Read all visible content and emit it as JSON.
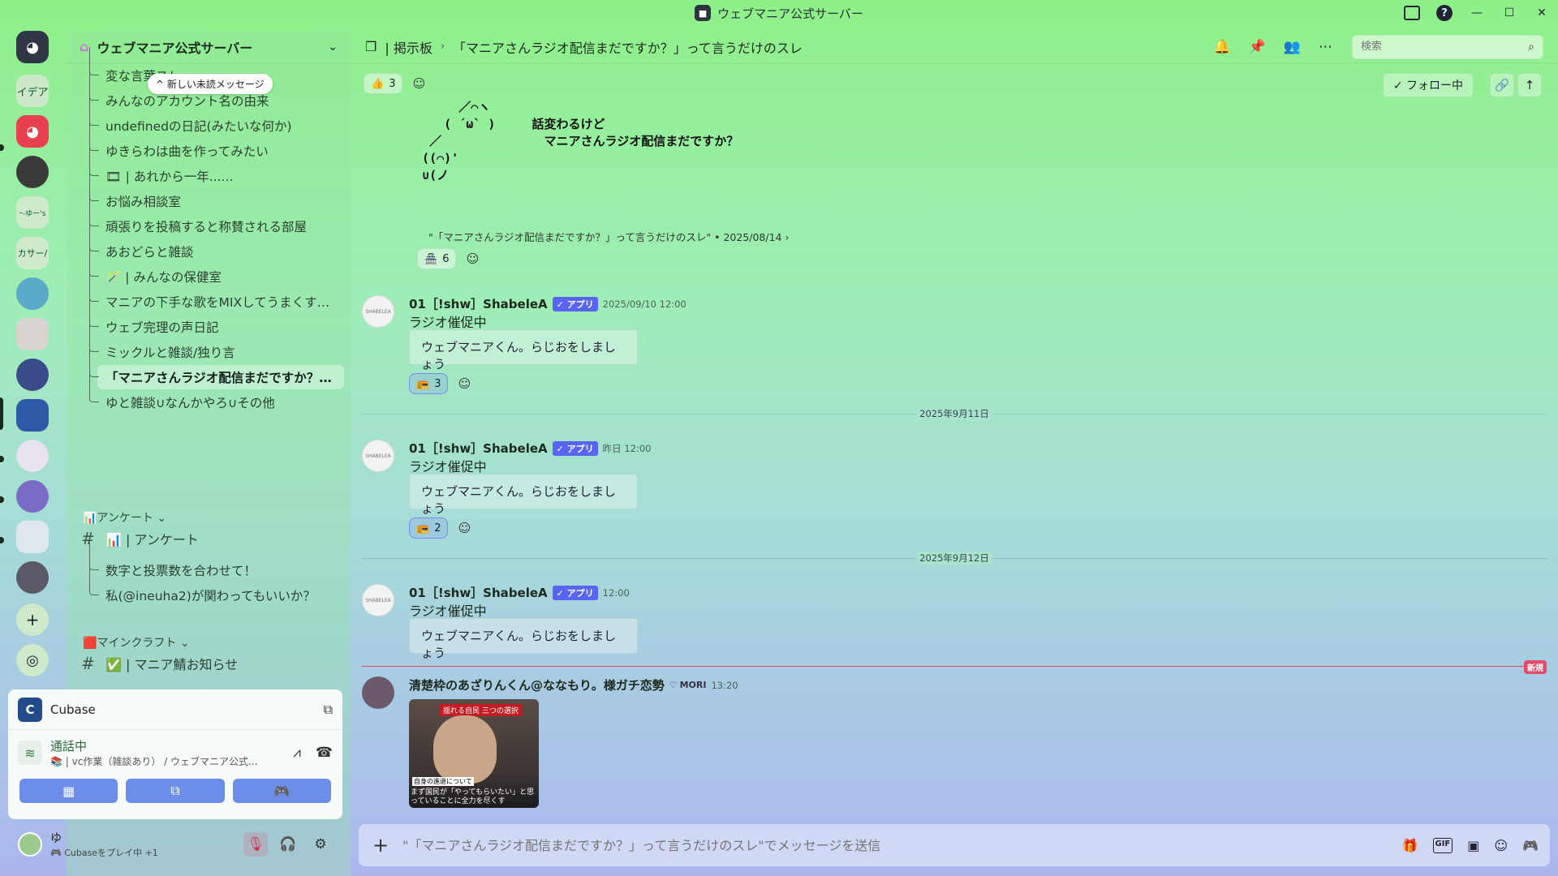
{
  "window": {
    "title": "ウェブマニア公式サーバー",
    "title_icon": "server-logo"
  },
  "rail": {
    "home_icon": "discord-logo",
    "servers": [
      {
        "name": "イデア",
        "label": "イデア"
      },
      {
        "name": "discord",
        "label": ""
      },
      {
        "name": "server-3",
        "label": ""
      },
      {
        "name": "server-4",
        "label": "ｰ-ゆー's"
      },
      {
        "name": "server-5",
        "label": "カサー/"
      },
      {
        "name": "server-6",
        "label": ""
      },
      {
        "name": "server-7",
        "label": ""
      },
      {
        "name": "server-8",
        "label": ""
      },
      {
        "name": "server-9",
        "label": ""
      },
      {
        "name": "server-10",
        "label": ""
      },
      {
        "name": "server-11",
        "label": ""
      },
      {
        "name": "server-12",
        "label": ""
      },
      {
        "name": "server-13",
        "label": ""
      }
    ],
    "add_label": "+",
    "explore_label": "◎"
  },
  "sidebar": {
    "server_name": "ウェブマニア公式サーバー",
    "new_unread": "^ 新しい未読メッセージ",
    "threads": [
      "変な言葉スレ",
      "みんなのアカウント名の由来",
      "undefinedの日記(みたいな何か)",
      "ゆきらわは曲を作ってみたい",
      "🎞 | あれから一年......",
      "お悩み相談室",
      "頑張りを投稿すると称賛される部屋",
      "あおどらと雑談",
      "🪄 | みんなの保健室",
      "マニアの下手な歌をMIXしてうまくする部屋",
      "ウェブ完理の声日記",
      "ミックルと雑談/独り言",
      "「マニアさんラジオ配信まだですか？」って言うだけのスレ",
      "ゆと雑談∪なんかやろ∪その他"
    ],
    "active_index": 12,
    "category_poll": "📊アンケート ⌄",
    "poll_channel": "📊 | アンケート",
    "poll_threads": [
      "数字と投票数を合わせて！",
      "私(@ineuha2)が関わってもいいか？"
    ],
    "category_mc": "🟥マインクラフト ⌄",
    "mc_channel": "✅ | マニア鯖お知らせ"
  },
  "activity": {
    "app_name": "Cubase",
    "voice_status": "通話中",
    "voice_channel": "📚 | vc作業（雑談あり） / ウェブマニア公式...",
    "user_name": "ゆ",
    "user_status": "🎮 Cubaseをプレイ中 +1"
  },
  "header": {
    "forum_icon": "forum-icon",
    "forum_name": "| 掲示板",
    "thread_title": "「マニアさんラジオ配信まだですか？」って言うだけのスレ",
    "search_placeholder": "検索"
  },
  "thread_bar": {
    "reaction_emoji": "👍",
    "reaction_count": "3",
    "follow_label": "✓ フォロー中"
  },
  "messages": {
    "ascii_art": "       ／⌒ヽ\n     ( ´ω` )     話変わるけど\n   ／              マニアさんラジオ配信まだですか？\n  ((⌒)'\n  ∪(ノ",
    "quote": "\"「マニアさんラジオ配信まだですか？」って言うだけのスレ\" • 2025/08/14  ›",
    "quote_reaction_emoji": "🏯",
    "quote_reaction_count": "6",
    "bot_name": "01［!shw］ShabeleA",
    "app_badge": "✓ アプリ",
    "bot_avatar_text": "SHABELEA",
    "items": [
      {
        "time": "2025/09/10 12:00",
        "body": "ラジオ催促中",
        "embed": "ウェブマニアくん。らじおをしましょう",
        "reaction_emoji": "📻",
        "reaction_count": "3"
      },
      {
        "time": "昨日 12:00",
        "body": "ラジオ催促中",
        "embed": "ウェブマニアくん。らじおをしましょう",
        "reaction_emoji": "📻",
        "reaction_count": "2"
      },
      {
        "time": "12:00",
        "body": "ラジオ催促中",
        "embed": "ウェブマニアくん。らじおをしましょう"
      }
    ],
    "date_1": "2025年9月11日",
    "date_2": "2025年9月12日",
    "new_label": "新規",
    "last_user": "清楚枠のあざりんくん@ななもり。様ガチ恋勢",
    "last_role": "MORI",
    "last_time": "13:20",
    "image_banner": "揺れる自民 三つの選択",
    "image_caption_1": "自身の進退について",
    "image_caption_2": "まず国民が「やってもらいたい」と思っていることに全力を尽くす"
  },
  "composer": {
    "placeholder": "\"「マニアさんラジオ配信まだですか？」って言うだけのスレ\"でメッセージを送信"
  }
}
